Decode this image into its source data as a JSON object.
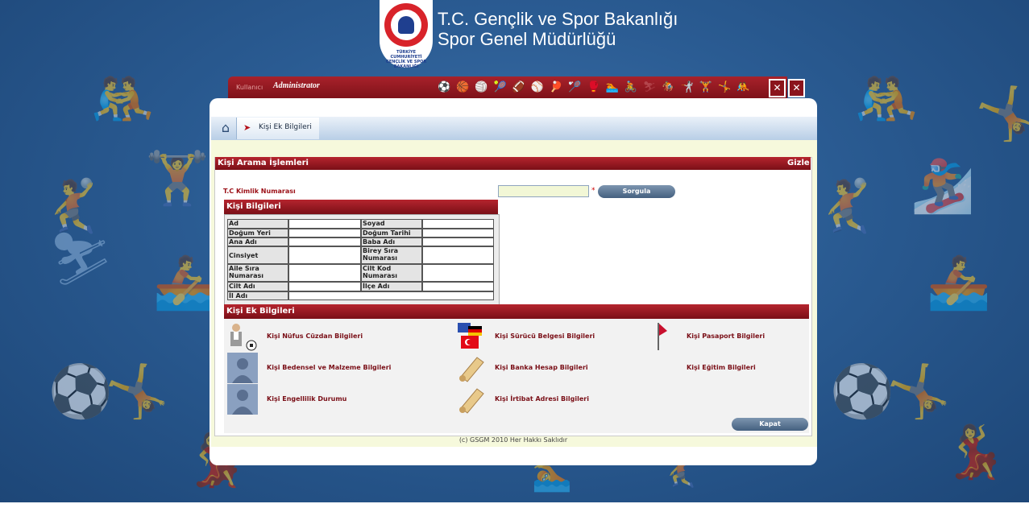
{
  "brand": {
    "line1": "T.C. Gençlik ve Spor Bakanlığı",
    "line2": "Spor Genel Müdürlüğü",
    "logo_text": "TÜRKİYE CUMHURİYETİ GENÇLİK VE SPOR BAKANLIĞI"
  },
  "userbar": {
    "label": "Kullanıcı",
    "user": "Administrator",
    "close_glyph": "✕"
  },
  "breadcrumb": {
    "current": "Kişi Ek Bilgileri"
  },
  "search_section": {
    "title": "Kişi Arama İşlemleri",
    "hide_label": "Gizle",
    "tc_label": "T.C Kimlik Numarası",
    "required_mark": "*",
    "query_button": "Sorgula"
  },
  "person_info": {
    "title": "Kişi Bilgileri",
    "fields": {
      "ad": "Ad",
      "soyad": "Soyad",
      "dogum_yeri": "Doğum Yeri",
      "dogum_tarihi": "Doğum Tarihi",
      "ana_adi": "Ana Adı",
      "baba_adi": "Baba Adı",
      "cinsiyet": "Cinsiyet",
      "birey_sira_no": "Birey Sıra Numarası",
      "aile_sira_no": "Aile Sıra Numarası",
      "cilt_kod_no": "Cilt Kod Numarası",
      "cilt_adi": "Cilt Adı",
      "ilce_adi": "İlçe Adı",
      "il_adi": "İl Adı"
    }
  },
  "extra_info": {
    "title": "Kişi Ek Bilgileri",
    "links": [
      "Kişi Nüfus Cüzdan Bilgileri",
      "Kişi Sürücü Belgesi Bilgileri",
      "Kişi Pasaport Bilgileri",
      "Kişi Bedensel ve Malzeme Bilgileri",
      "Kişi Banka Hesap Bilgileri",
      "Kişi Eğitim Bilgileri",
      "Kişi Engellilik Durumu",
      "Kişi İrtibat Adresi Bilgileri"
    ],
    "close_button": "Kapat"
  },
  "footer": "(c) GSGM 2010 Her Hakkı Saklıdır",
  "colors": {
    "background": "#2a5b92",
    "accent_red": "#8b141c",
    "link_red": "#7a0f17",
    "button_blue": "#44607f"
  }
}
